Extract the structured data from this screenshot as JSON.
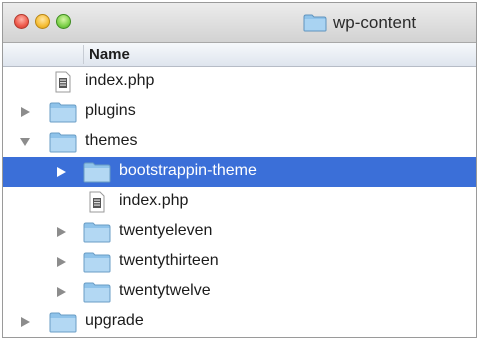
{
  "window": {
    "title": "wp-content"
  },
  "columns": {
    "name": "Name"
  },
  "items": [
    {
      "label": "index.php",
      "type": "file",
      "depth": 0,
      "disclosure": "none",
      "selected": false
    },
    {
      "label": "plugins",
      "type": "folder",
      "depth": 0,
      "disclosure": "collapsed",
      "selected": false
    },
    {
      "label": "themes",
      "type": "folder",
      "depth": 0,
      "disclosure": "expanded",
      "selected": false
    },
    {
      "label": "bootstrappin-theme",
      "type": "folder",
      "depth": 1,
      "disclosure": "collapsed",
      "selected": true
    },
    {
      "label": "index.php",
      "type": "file",
      "depth": 1,
      "disclosure": "none",
      "selected": false
    },
    {
      "label": "twentyeleven",
      "type": "folder",
      "depth": 1,
      "disclosure": "collapsed",
      "selected": false
    },
    {
      "label": "twentythirteen",
      "type": "folder",
      "depth": 1,
      "disclosure": "collapsed",
      "selected": false
    },
    {
      "label": "twentytwelve",
      "type": "folder",
      "depth": 1,
      "disclosure": "collapsed",
      "selected": false
    },
    {
      "label": "upgrade",
      "type": "folder",
      "depth": 0,
      "disclosure": "collapsed",
      "selected": false
    }
  ],
  "colors": {
    "selection": "#3b6fd8",
    "folder": "#8fc3ea"
  },
  "icons": {
    "folder": "folder-icon",
    "file": "php-file-icon",
    "collapsed": "disclosure-right-icon",
    "expanded": "disclosure-down-icon"
  }
}
